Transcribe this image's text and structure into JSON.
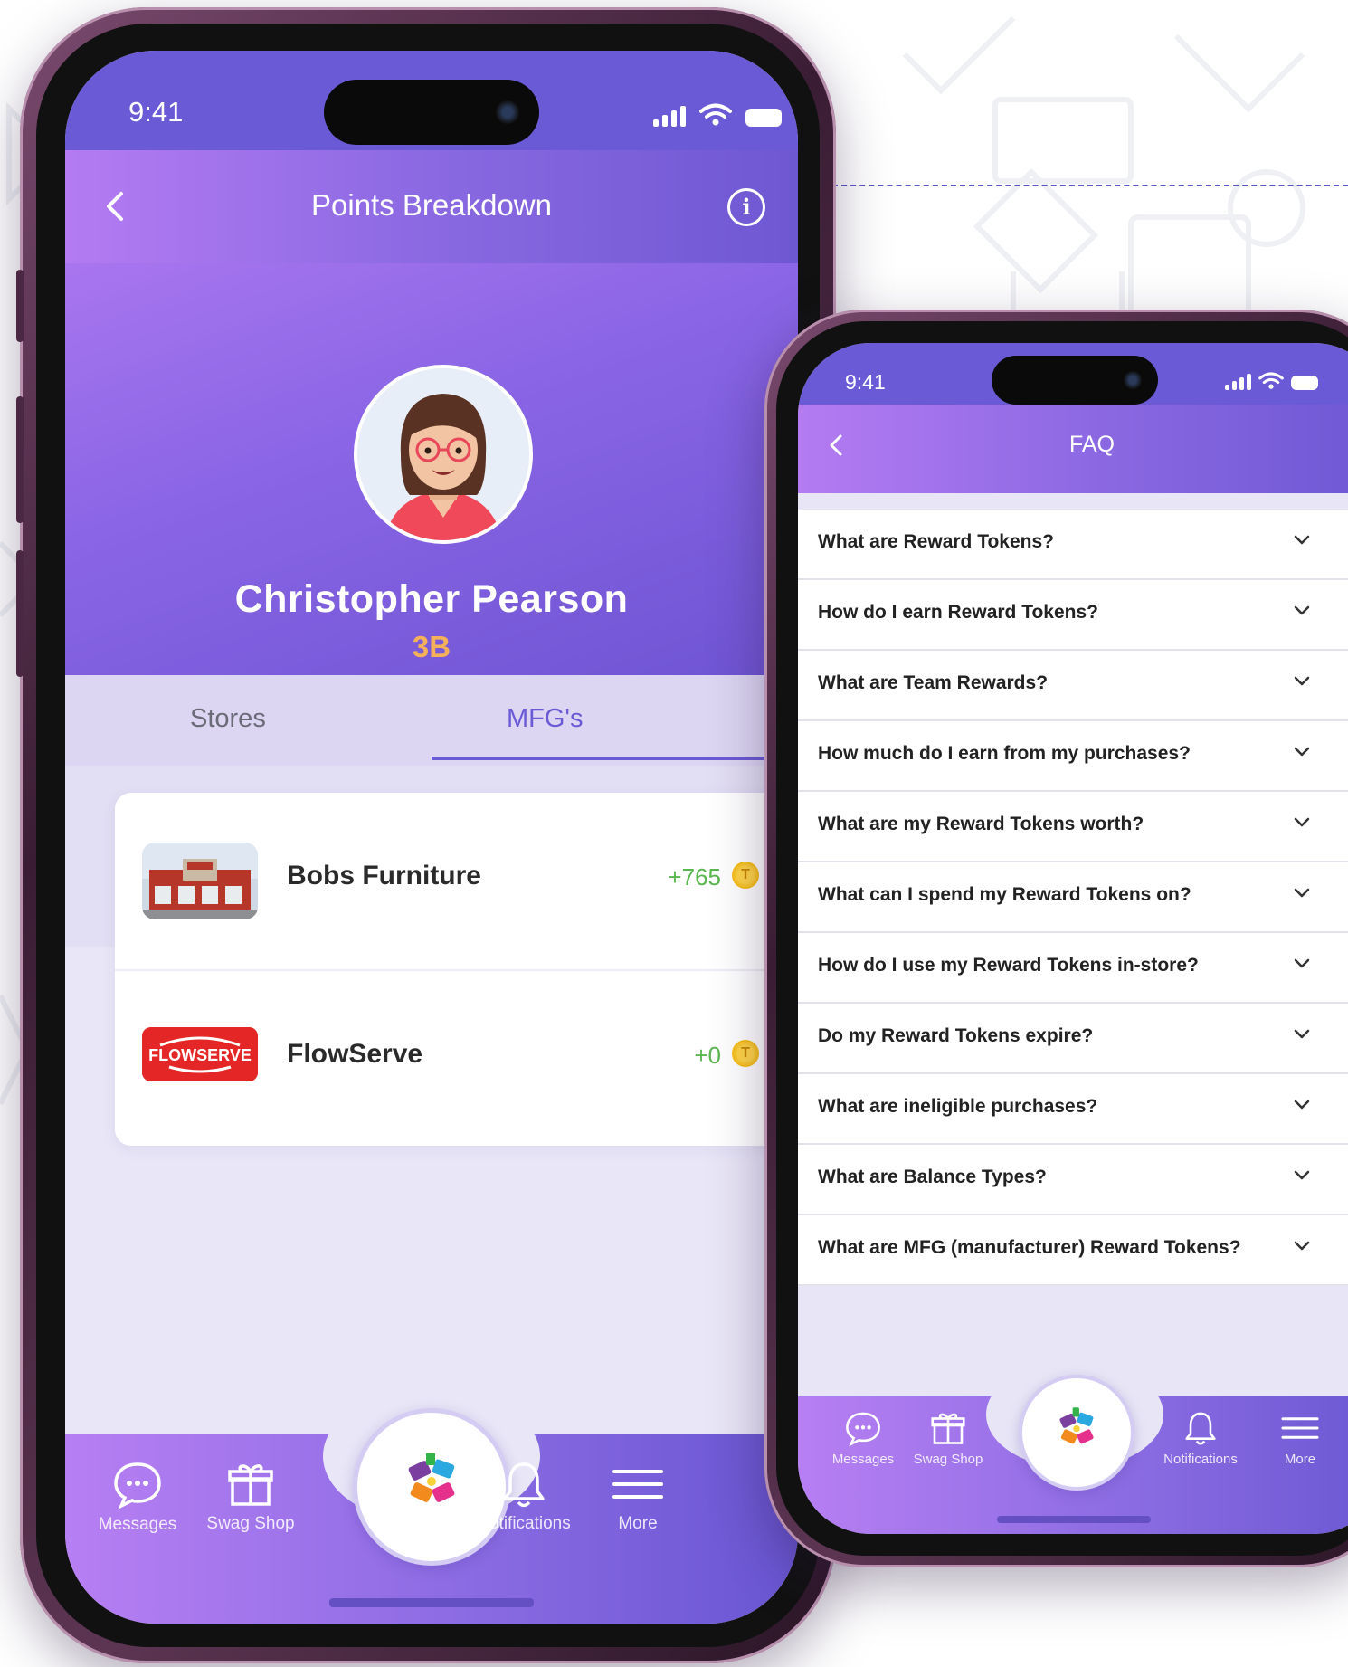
{
  "colors": {
    "brand_purple": "#6a5ad6",
    "brand_light_purple": "#b47bf2",
    "level_orange": "#f5b15a",
    "points_green": "#5ab64f",
    "dash_line": "#5b52c9"
  },
  "points_screen": {
    "status": {
      "time": "9:41"
    },
    "header": {
      "title": "Points Breakdown",
      "back_icon": "chevron-left-icon",
      "info_icon": "info-icon"
    },
    "profile": {
      "name": "Christopher Pearson",
      "level": "3B"
    },
    "tabs": [
      {
        "label": "Stores",
        "active": false
      },
      {
        "label": "MFG's",
        "active": true
      }
    ],
    "entries": [
      {
        "name": "Bobs Furniture",
        "points": "+765",
        "logo": "storefront-photo"
      },
      {
        "name": "FlowServe",
        "points": "+0",
        "logo": "flowserve-logo",
        "logo_text": "FLOWSERVE"
      }
    ],
    "nav": [
      {
        "label": "Messages",
        "icon": "chat-bubble-icon"
      },
      {
        "label": "Swag Shop",
        "icon": "gift-icon"
      },
      {
        "label": "Notifications",
        "icon": "bell-icon"
      },
      {
        "label": "More",
        "icon": "menu-lines-icon"
      }
    ]
  },
  "faq_screen": {
    "status": {
      "time": "9:41"
    },
    "header": {
      "title": "FAQ",
      "back_icon": "chevron-left-icon"
    },
    "questions": [
      "What are Reward Tokens?",
      "How do I earn Reward Tokens?",
      "What are Team Rewards?",
      "How much do I earn from my purchases?",
      "What are my Reward Tokens worth?",
      "What can I spend my Reward Tokens on?",
      "How do I use my Reward Tokens in-store?",
      "Do my Reward Tokens expire?",
      "What are ineligible purchases?",
      "What are Balance Types?",
      "What are MFG (manufacturer) Reward Tokens?"
    ],
    "nav": [
      {
        "label": "Messages",
        "icon": "chat-bubble-icon"
      },
      {
        "label": "Swag Shop",
        "icon": "gift-icon"
      },
      {
        "label": "Notifications",
        "icon": "bell-icon"
      },
      {
        "label": "More",
        "icon": "menu-lines-icon"
      }
    ]
  }
}
